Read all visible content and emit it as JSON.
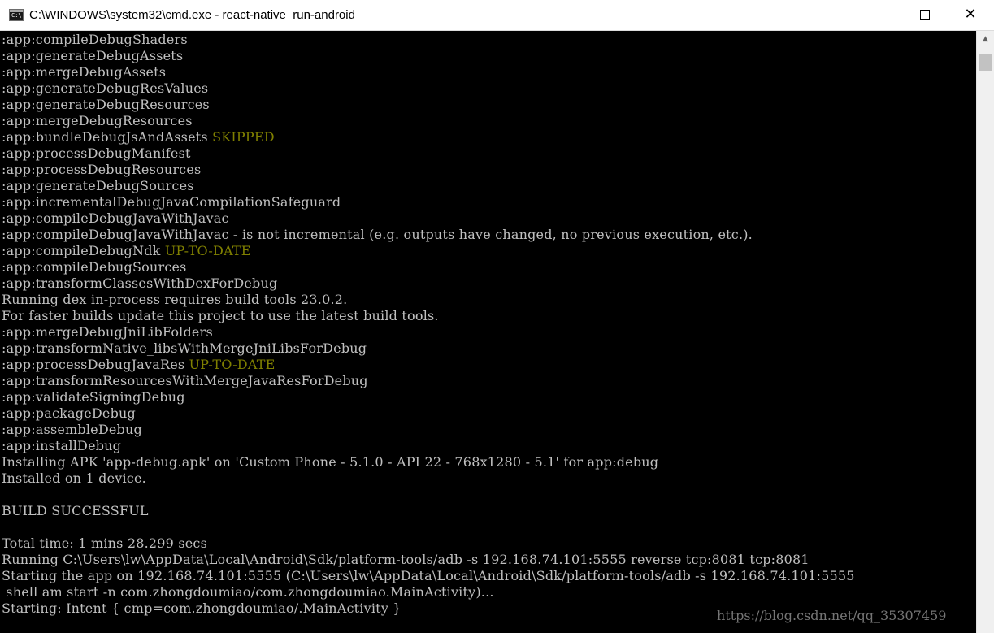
{
  "window": {
    "title": "C:\\WINDOWS\\system32\\cmd.exe - react-native  run-android",
    "icon_label": "C:\\",
    "icon": "cmd-prompt-icon",
    "controls": {
      "minimize_icon": "minimize-icon",
      "maximize_icon": "maximize-icon",
      "close_icon": "close-icon",
      "close_glyph": "✕"
    }
  },
  "colors": {
    "background": "#000000",
    "text": "#c0c0c0",
    "status_tag": "#808000",
    "titlebar": "#ffffff"
  },
  "console": {
    "lines": [
      {
        "text": ":app:compileDebugShaders",
        "tag": ""
      },
      {
        "text": ":app:generateDebugAssets",
        "tag": ""
      },
      {
        "text": ":app:mergeDebugAssets",
        "tag": ""
      },
      {
        "text": ":app:generateDebugResValues",
        "tag": ""
      },
      {
        "text": ":app:generateDebugResources",
        "tag": ""
      },
      {
        "text": ":app:mergeDebugResources",
        "tag": ""
      },
      {
        "text": ":app:bundleDebugJsAndAssets ",
        "tag": "SKIPPED"
      },
      {
        "text": ":app:processDebugManifest",
        "tag": ""
      },
      {
        "text": ":app:processDebugResources",
        "tag": ""
      },
      {
        "text": ":app:generateDebugSources",
        "tag": ""
      },
      {
        "text": ":app:incrementalDebugJavaCompilationSafeguard",
        "tag": ""
      },
      {
        "text": ":app:compileDebugJavaWithJavac",
        "tag": ""
      },
      {
        "text": ":app:compileDebugJavaWithJavac - is not incremental (e.g. outputs have changed, no previous execution, etc.).",
        "tag": ""
      },
      {
        "text": ":app:compileDebugNdk ",
        "tag": "UP-TO-DATE"
      },
      {
        "text": ":app:compileDebugSources",
        "tag": ""
      },
      {
        "text": ":app:transformClassesWithDexForDebug",
        "tag": ""
      },
      {
        "text": "Running dex in-process requires build tools 23.0.2.",
        "tag": ""
      },
      {
        "text": "For faster builds update this project to use the latest build tools.",
        "tag": ""
      },
      {
        "text": ":app:mergeDebugJniLibFolders",
        "tag": ""
      },
      {
        "text": ":app:transformNative_libsWithMergeJniLibsForDebug",
        "tag": ""
      },
      {
        "text": ":app:processDebugJavaRes ",
        "tag": "UP-TO-DATE"
      },
      {
        "text": ":app:transformResourcesWithMergeJavaResForDebug",
        "tag": ""
      },
      {
        "text": ":app:validateSigningDebug",
        "tag": ""
      },
      {
        "text": ":app:packageDebug",
        "tag": ""
      },
      {
        "text": ":app:assembleDebug",
        "tag": ""
      },
      {
        "text": ":app:installDebug",
        "tag": ""
      },
      {
        "text": "Installing APK 'app-debug.apk' on 'Custom Phone - 5.1.0 - API 22 - 768x1280 - 5.1' for app:debug",
        "tag": ""
      },
      {
        "text": "Installed on 1 device.",
        "tag": ""
      },
      {
        "text": "",
        "tag": ""
      },
      {
        "text": "BUILD SUCCESSFUL",
        "tag": ""
      },
      {
        "text": "",
        "tag": ""
      },
      {
        "text": "Total time: 1 mins 28.299 secs",
        "tag": ""
      },
      {
        "text": "Running C:\\Users\\lw\\AppData\\Local\\Android\\Sdk/platform-tools/adb -s 192.168.74.101:5555 reverse tcp:8081 tcp:8081",
        "tag": ""
      },
      {
        "text": "Starting the app on 192.168.74.101:5555 (C:\\Users\\lw\\AppData\\Local\\Android\\Sdk/platform-tools/adb -s 192.168.74.101:5555",
        "tag": ""
      },
      {
        "text": " shell am start -n com.zhongdoumiao/com.zhongdoumiao.MainActivity)...",
        "tag": ""
      },
      {
        "text": "Starting: Intent { cmp=com.zhongdoumiao/.MainActivity }",
        "tag": ""
      }
    ]
  },
  "watermark": "https://blog.csdn.net/qq_35307459",
  "scrollbar": {
    "up_glyph": "▲",
    "up_icon": "scroll-up-arrow-icon"
  }
}
